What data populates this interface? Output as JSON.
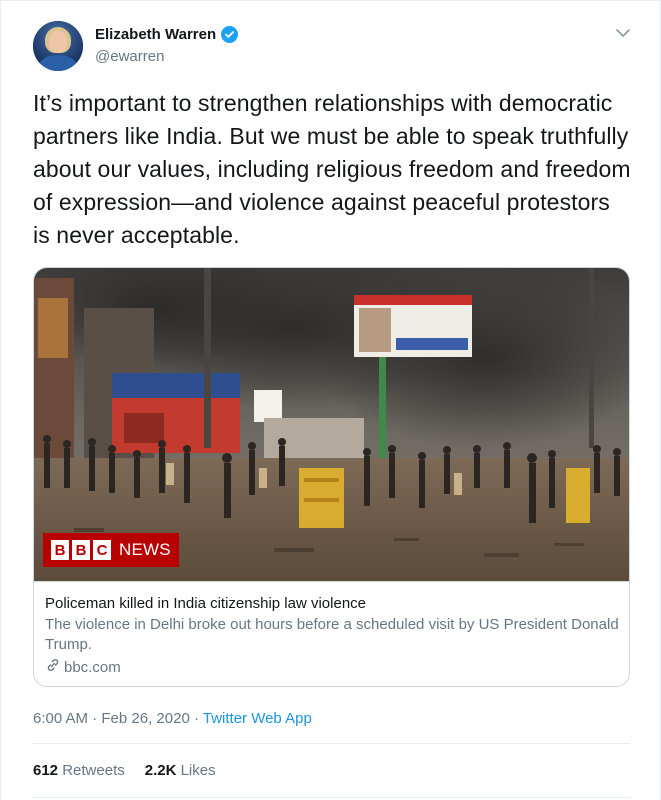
{
  "author": {
    "display_name": "Elizabeth Warren",
    "handle": "@ewarren",
    "verified": true
  },
  "tweet": {
    "text": "It’s important to strengthen relationships with democratic partners like India. But we must be able to speak truthfully about our values, including religious freedom and freedom of expression—and violence against peaceful protestors is never acceptable."
  },
  "card": {
    "image_badge": {
      "box_letters": [
        "B",
        "B",
        "C"
      ],
      "label": "NEWS"
    },
    "title": "Policeman killed in India citizenship law violence",
    "description": "The violence in Delhi broke out hours before a scheduled visit by US President Donald Trump.",
    "domain": "bbc.com"
  },
  "meta": {
    "time": "6:00 AM",
    "separator1": " · ",
    "date": "Feb 26, 2020",
    "separator2": " · ",
    "source": "Twitter Web App"
  },
  "stats": {
    "retweets_count": "612",
    "retweets_label": "Retweets",
    "likes_count": "2.2K",
    "likes_label": "Likes"
  },
  "icons": {
    "verified": "verified-badge-icon",
    "caret": "chevron-down-icon",
    "link": "link-icon"
  },
  "colors": {
    "link_blue": "#1b95e0",
    "verified_blue": "#1da1f2",
    "bbc_red": "#b80000",
    "muted": "#657786"
  }
}
